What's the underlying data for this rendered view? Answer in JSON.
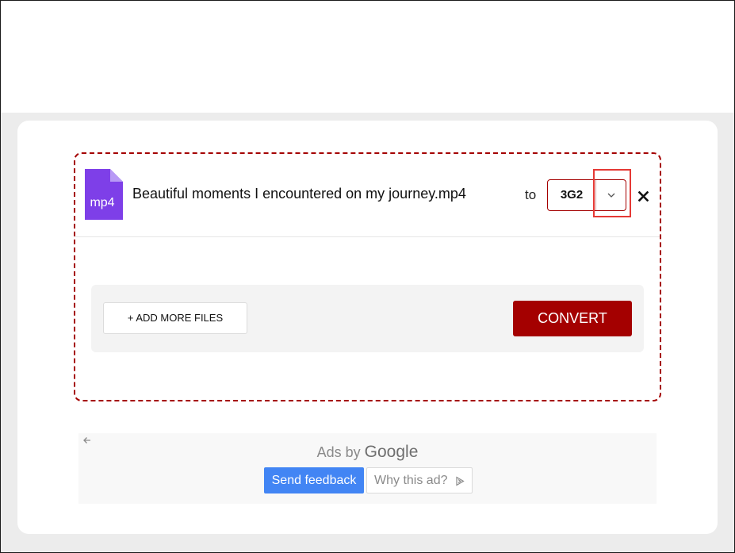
{
  "file": {
    "icon": "file-icon",
    "extension": "mp4",
    "name": "Beautiful moments I encountered on my journey.mp4",
    "icon_color": "#7e3fe8"
  },
  "conversion": {
    "to_label": "to",
    "format": "3G2",
    "caret_icon": "chevron-down-icon",
    "remove_icon": "close-icon"
  },
  "actions": {
    "add_files_label": "+ ADD MORE FILES",
    "convert_label": "CONVERT",
    "accent_color": "#a40000"
  },
  "ads": {
    "back_icon": "arrow-left-icon",
    "ads_by": "Ads by",
    "provider": "Google",
    "send_feedback": "Send feedback",
    "why_this_ad": "Why this ad?",
    "why_icon": "adchoices-icon",
    "feedback_color": "#4285f4"
  }
}
